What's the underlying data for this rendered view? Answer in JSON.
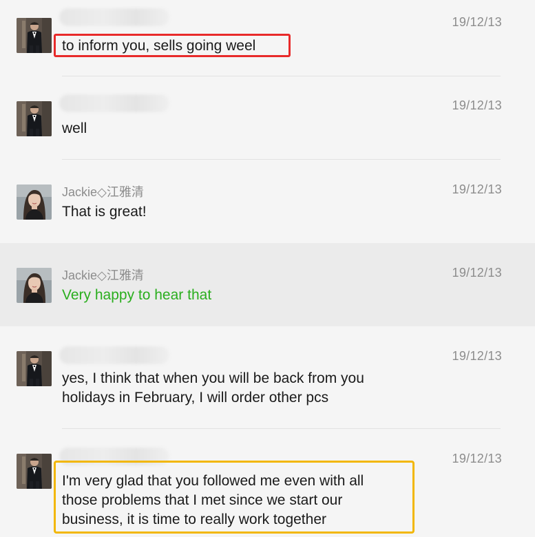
{
  "messages": [
    {
      "sender": "",
      "time": "19/12/13",
      "text": "to inform you, sells going weel",
      "avatar": "man-in-suit"
    },
    {
      "sender": "",
      "time": "19/12/13",
      "text": "well",
      "avatar": "man-in-suit"
    },
    {
      "sender": "Jackie◇江雅清",
      "time": "19/12/13",
      "text": "That is great!",
      "avatar": "woman-portrait"
    },
    {
      "sender": "Jackie◇江雅清",
      "time": "19/12/13",
      "text": "Very happy to hear that",
      "avatar": "woman-portrait"
    },
    {
      "sender": "",
      "time": "19/12/13",
      "text": "yes, I think that when you will be back from you\nholidays in February, I will order other pcs",
      "avatar": "man-in-suit"
    },
    {
      "sender": "",
      "time": "19/12/13",
      "text": "I'm very glad that you followed me even with all\nthose problems that I met since we start our\nbusiness, it is time to really work together",
      "avatar": "man-in-suit"
    }
  ],
  "colors": {
    "background": "#f5f5f5",
    "highlight_row": "#ebebeb",
    "green_text": "#2aae1e",
    "red_box": "#e82a2a",
    "yellow_box": "#f2b705"
  }
}
